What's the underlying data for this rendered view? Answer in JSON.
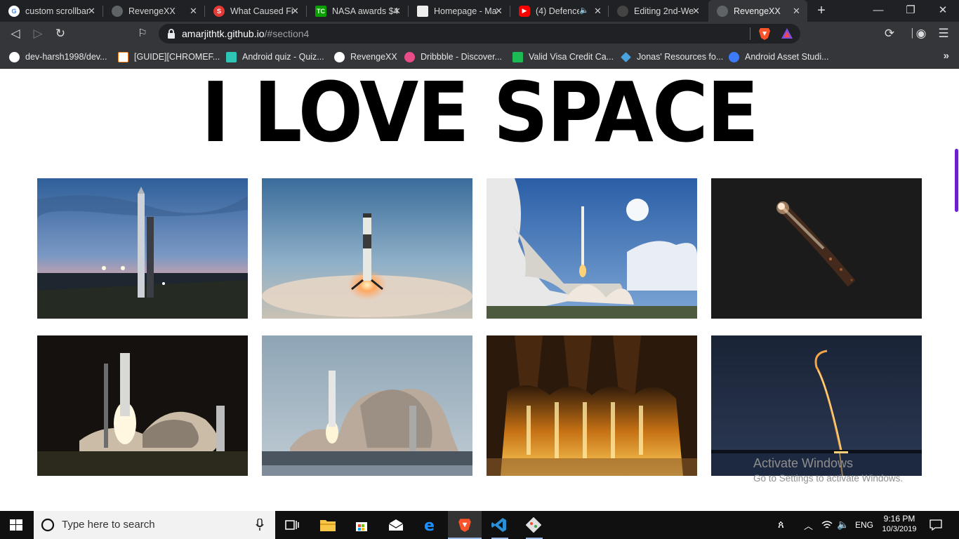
{
  "browser": {
    "tabs": [
      {
        "title": "custom scrollbar",
        "favicon": "google-icon",
        "active": false
      },
      {
        "title": "RevengeXX",
        "favicon": "globe-icon",
        "active": false
      },
      {
        "title": "What Caused Fi",
        "favicon": "site-s-icon",
        "active": false
      },
      {
        "title": "NASA awards $4",
        "favicon": "techcrunch-icon",
        "active": false
      },
      {
        "title": "Homepage - Ma",
        "favicon": "page-icon",
        "active": false
      },
      {
        "title": "(4) Defence",
        "favicon": "youtube-icon",
        "active": false,
        "audio": true
      },
      {
        "title": "Editing 2nd-We",
        "favicon": "github-icon",
        "active": false
      },
      {
        "title": "RevengeXX",
        "favicon": "globe-icon",
        "active": true
      }
    ],
    "address": {
      "host": "amarjithtk.github.io",
      "path": "/#section4"
    },
    "bookmarks": [
      {
        "label": "dev-harsh1998/dev...",
        "icon": "github-icon",
        "color": "#ffffff"
      },
      {
        "label": "[GUIDE][CHROMEF...",
        "icon": "xda-icon",
        "color": "#f58220"
      },
      {
        "label": "Android quiz - Quiz...",
        "icon": "hourglass-icon",
        "color": "#2ec4b6"
      },
      {
        "label": "RevengeXX",
        "icon": "github-icon",
        "color": "#ffffff"
      },
      {
        "label": "Dribbble - Discover...",
        "icon": "dribbble-icon",
        "color": "#ea4c89"
      },
      {
        "label": "Valid Visa Credit Ca...",
        "icon": "card-icon",
        "color": "#1db954"
      },
      {
        "label": "Jonas' Resources fo...",
        "icon": "diamond-icon",
        "color": "#4aa3df"
      },
      {
        "label": "Android Asset Studi...",
        "icon": "asset-studio-icon",
        "color": "#3d7bfd"
      }
    ]
  },
  "page": {
    "headline": "I LOVE SPACE",
    "photos": [
      {
        "scene": "rocket-on-pad-dusk"
      },
      {
        "scene": "booster-landing"
      },
      {
        "scene": "launch-clouds-sunny"
      },
      {
        "scene": "streak-night-dark"
      },
      {
        "scene": "falcon-heavy-night-launch"
      },
      {
        "scene": "falcon-heavy-day-launch"
      },
      {
        "scene": "engines-firing-orange"
      },
      {
        "scene": "arc-trail-night-sky"
      }
    ],
    "accent": "#6a1fd1"
  },
  "watermark": {
    "line1": "Activate Windows",
    "line2": "Go to Settings to activate Windows."
  },
  "taskbar": {
    "search_placeholder": "Type here to search",
    "lang": "ENG",
    "time": "9:16 PM",
    "date": "10/3/2019"
  }
}
